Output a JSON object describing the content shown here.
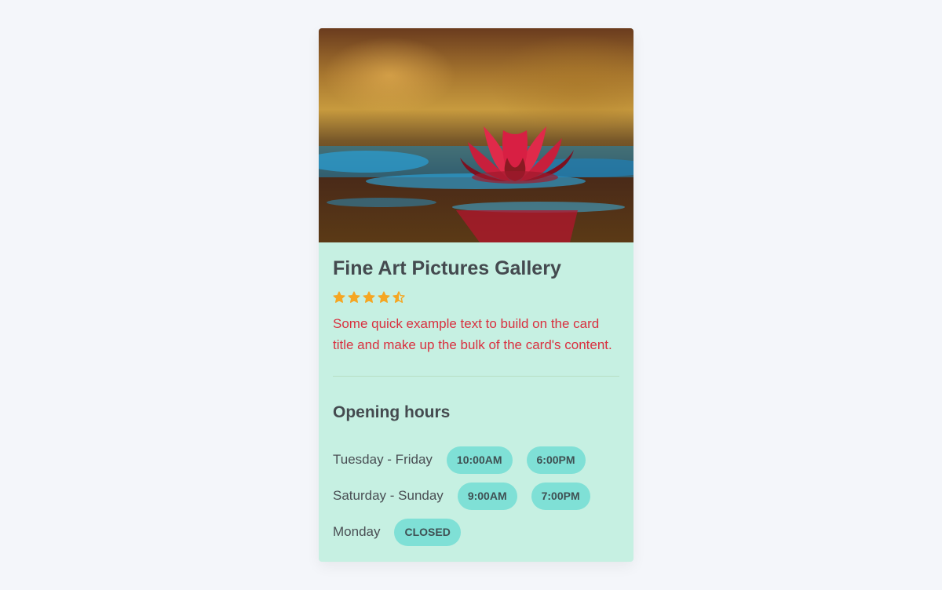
{
  "card": {
    "image_alt": "Red water lily on a pond",
    "title": "Fine Art Pictures Gallery",
    "rating": 4.5,
    "rating_color": "#f5a623",
    "text": "Some quick example text to build on the card title and make up the bulk of the card's content.",
    "section_title": "Opening hours",
    "hours": [
      {
        "day": "Tuesday - Friday",
        "times": [
          "10:00AM",
          "6:00PM"
        ]
      },
      {
        "day": "Saturday - Sunday",
        "times": [
          "9:00AM",
          "7:00PM"
        ]
      },
      {
        "day": "Monday",
        "times": [
          "CLOSED"
        ]
      }
    ]
  }
}
